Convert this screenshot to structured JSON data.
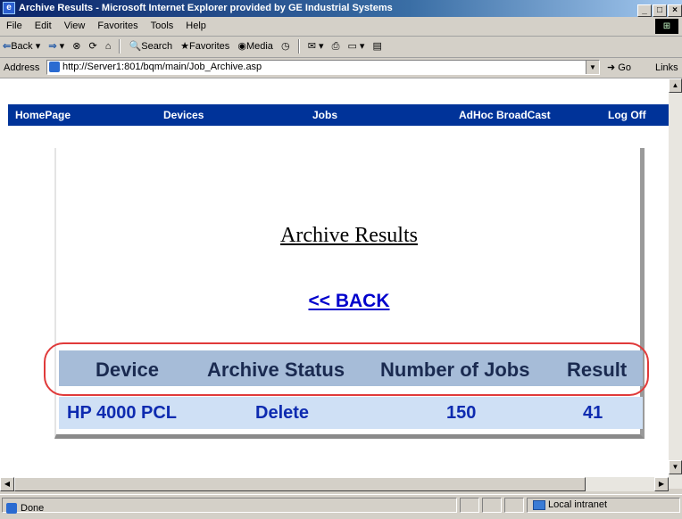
{
  "window": {
    "title": "Archive Results - Microsoft Internet Explorer provided by GE Industrial Systems",
    "controls": [
      "_",
      "□",
      "×"
    ]
  },
  "menu": [
    "File",
    "Edit",
    "View",
    "Favorites",
    "Tools",
    "Help"
  ],
  "toolbar": {
    "back": "Back",
    "search": "Search",
    "favorites": "Favorites",
    "media": "Media"
  },
  "address": {
    "label": "Address",
    "url": "http://Server1:801/bqm/main/Job_Archive.asp",
    "go": "Go",
    "links": "Links"
  },
  "nav": [
    "HomePage",
    "Devices",
    "Jobs",
    "AdHoc BroadCast",
    "Log Off"
  ],
  "page": {
    "heading": "Archive Results",
    "back_link": "<< BACK"
  },
  "table": {
    "headers": [
      "Device",
      "Archive Status",
      "Number of Jobs",
      "Result"
    ],
    "rows": [
      [
        "HP 4000 PCL",
        "Delete",
        "150",
        "41"
      ]
    ]
  },
  "status": {
    "text": "Done",
    "zone": "Local intranet"
  },
  "colors": {
    "nav_bg": "#003399",
    "header_bg": "#a6bcd8",
    "row_bg": "#cfe0f5",
    "highlight": "#e03a3a"
  }
}
